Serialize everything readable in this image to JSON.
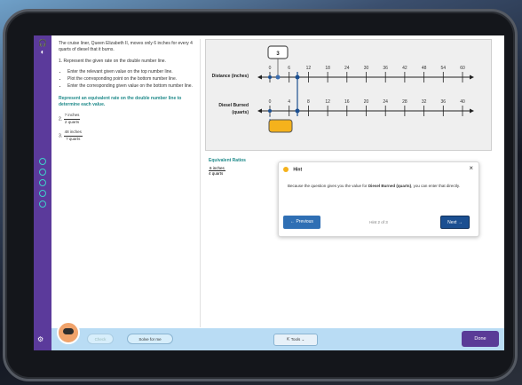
{
  "problem": {
    "intro": "The cruise liner, Queen Elizabeth II, moves only 6 inches for every 4 quarts of diesel that it burns.",
    "step1": "1.  Represent the given rate on the double number line.",
    "bullets": [
      "Enter the relevant given value on the top number line.",
      "Plot the corresponding point on the bottom number line.",
      "Enter the corresponding given value on the bottom number line."
    ],
    "instruction": "Represent an equivalent rate on the double number line to determine each value.",
    "q2_prefix": "2.",
    "q2_num": "? inches",
    "q2_den": "2 quarts",
    "q3_prefix": "3.",
    "q3_num": "48 inches",
    "q3_den": "? quarts"
  },
  "number_line": {
    "top_label": "Distance (inches)",
    "bottom_label_1": "Diesel Burned",
    "bottom_label_2": "(quarts)",
    "input_value": "3",
    "top_ticks": [
      "0",
      "6",
      "12",
      "18",
      "24",
      "30",
      "36",
      "42",
      "48",
      "54",
      "60"
    ],
    "bottom_ticks": [
      "0",
      "4",
      "8",
      "12",
      "16",
      "20",
      "24",
      "28",
      "32",
      "36",
      "40"
    ]
  },
  "equivalent_ratios": {
    "title": "Equivalent Ratios",
    "num": "6 inches",
    "den": "4 quarts"
  },
  "hint": {
    "title": "Hint",
    "body_pre": "Because the question gives you the value for ",
    "body_bold": "Diesel Burned (quarts)",
    "body_post": ", you can enter that directly.",
    "prev_label": "← Previous",
    "next_label": "Next →",
    "count": "Hint 2 of 3",
    "close": "×"
  },
  "bottom": {
    "check_label": "Check",
    "solve_label": "Solve for me",
    "tools_label": "⇱ Tools ⌄",
    "done_label": "Done"
  },
  "colors": {
    "sidebar": "#5b3a9b",
    "bottombar": "#b9dcf4",
    "accent_blue": "#2f6fb4",
    "point_blue": "#1b4f91",
    "input_yellow": "#f5b21c",
    "teal": "#1f8a8a"
  }
}
